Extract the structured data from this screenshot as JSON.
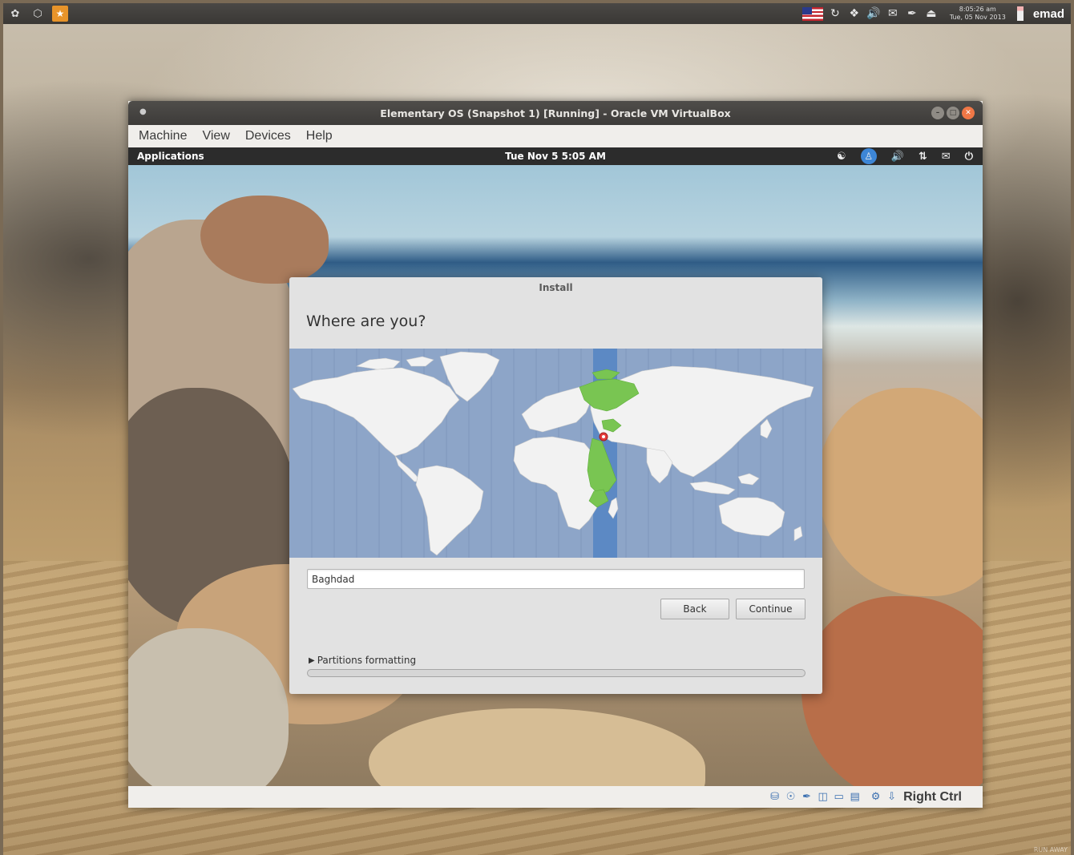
{
  "host_panel": {
    "left_icons": [
      "ubuntu-logo-icon",
      "virtualbox-icon",
      "app-icon"
    ],
    "tray_icons": [
      "us-flag-icon",
      "sync-icon",
      "wireless-icon",
      "volume-icon",
      "mail-icon",
      "pen-icon",
      "eject-icon"
    ],
    "clock_time": "8:05:26 am",
    "clock_date": "Tue, 05 Nov 2013",
    "username": "emad"
  },
  "vbox_window": {
    "title": "Elementary OS (Snapshot 1) [Running] - Oracle VM VirtualBox",
    "menu": [
      "Machine",
      "View",
      "Devices",
      "Help"
    ],
    "host_key": "Right Ctrl",
    "status_icons": [
      "hard-disk-icon",
      "optical-drive-icon",
      "usb-icon",
      "network-icon",
      "shared-folder-icon",
      "display-icon",
      "mouse-integration-icon",
      "host-key-icon"
    ]
  },
  "guest_panel": {
    "applications": "Applications",
    "clock": "Tue Nov  5  5:05 AM",
    "tray_icons": [
      "network-icon",
      "accessibility-icon",
      "volume-icon",
      "transfer-icon",
      "mail-icon",
      "power-icon"
    ]
  },
  "install_dialog": {
    "title": "Install",
    "heading": "Where are you?",
    "timezone_value": "Baghdad",
    "back_label": "Back",
    "continue_label": "Continue",
    "partitions_label": "Partitions formatting",
    "progress": 0,
    "colors": {
      "ocean": "#8da5c8",
      "selected_band": "#5c89c4",
      "land": "#f2f2f2",
      "highlight": "#79c552"
    }
  },
  "watermark": "RUN AWAY"
}
